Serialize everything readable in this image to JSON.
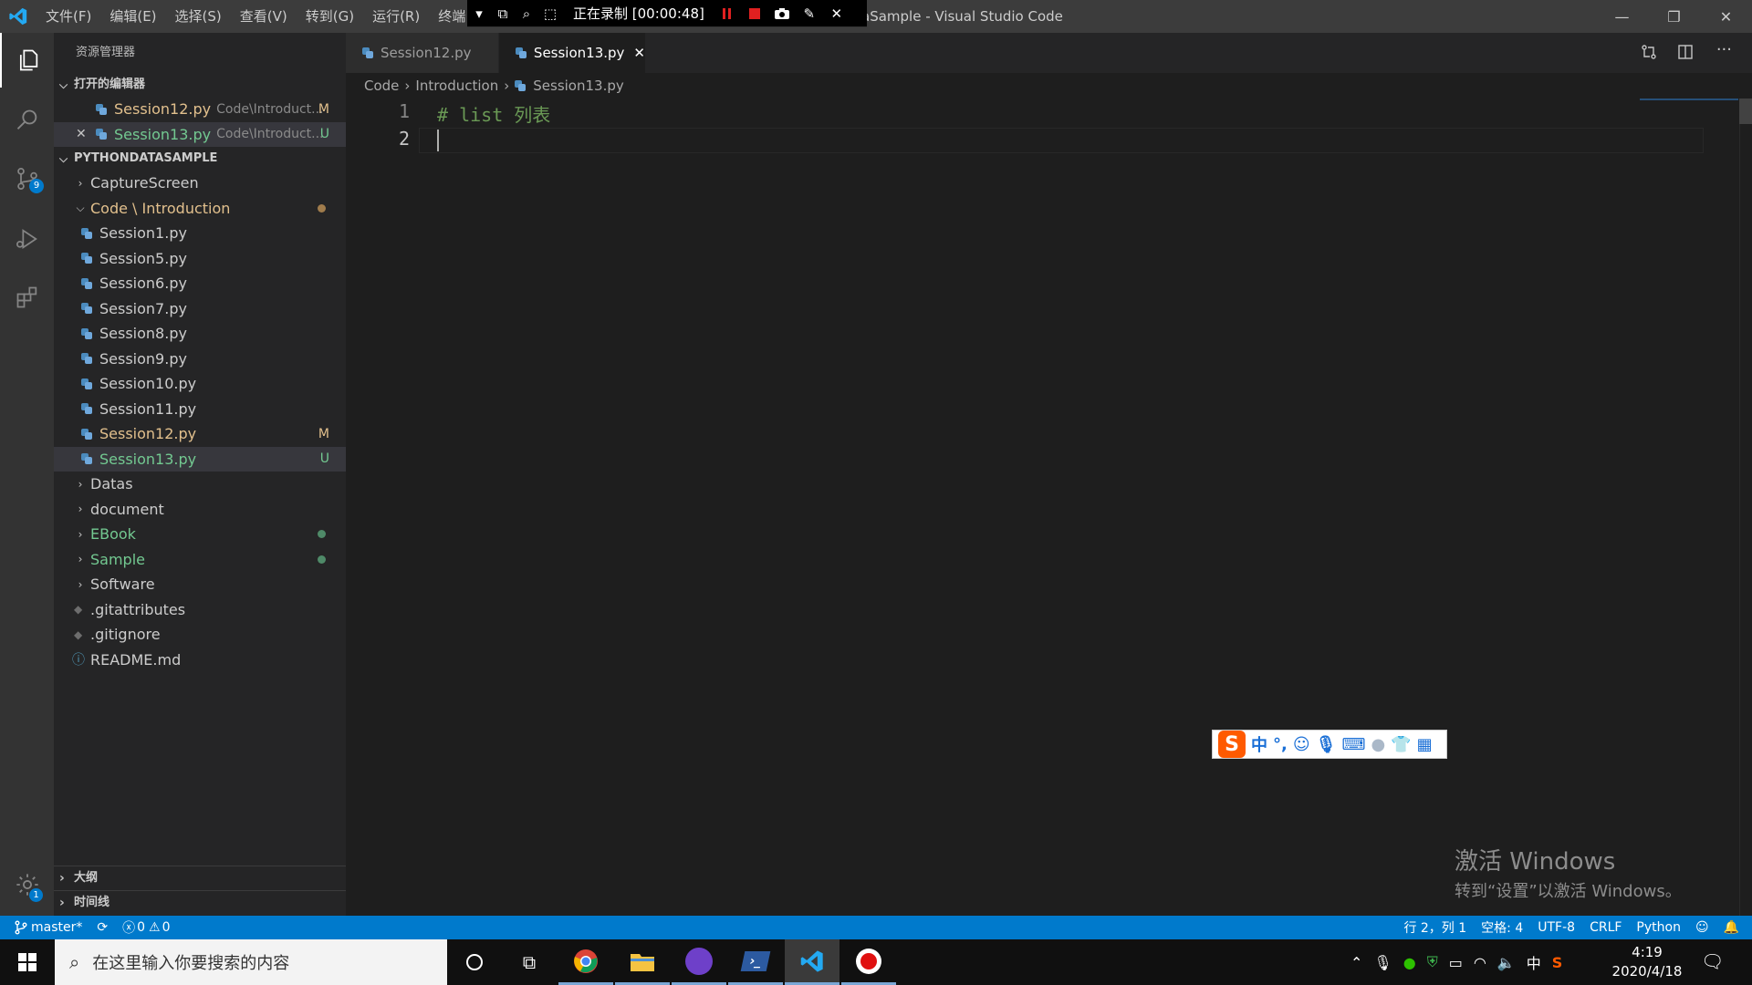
{
  "window": {
    "title": "aSample - Visual Studio Code"
  },
  "menu": [
    "文件(F)",
    "编辑(E)",
    "选择(S)",
    "查看(V)",
    "转到(G)",
    "运行(R)",
    "终端"
  ],
  "recorder": {
    "status": "正在录制 [00:00:48]"
  },
  "sidebar": {
    "title": "资源管理器",
    "open_editors": {
      "header": "打开的编辑器",
      "items": [
        {
          "name": "Session12.py",
          "path": "Code\\Introduct...",
          "badge": "M"
        },
        {
          "name": "Session13.py",
          "path": "Code\\Introduct...",
          "badge": "U"
        }
      ]
    },
    "workspace": {
      "header": "PYTHONDATASAMPLE",
      "items": [
        {
          "label": "CaptureScreen",
          "kind": "folder"
        },
        {
          "label": "Code \\ Introduction",
          "kind": "folder-open"
        },
        {
          "label": "Session1.py",
          "kind": "py"
        },
        {
          "label": "Session5.py",
          "kind": "py"
        },
        {
          "label": "Session6.py",
          "kind": "py"
        },
        {
          "label": "Session7.py",
          "kind": "py"
        },
        {
          "label": "Session8.py",
          "kind": "py"
        },
        {
          "label": "Session9.py",
          "kind": "py"
        },
        {
          "label": "Session10.py",
          "kind": "py"
        },
        {
          "label": "Session11.py",
          "kind": "py"
        },
        {
          "label": "Session12.py",
          "kind": "py",
          "badge": "M"
        },
        {
          "label": "Session13.py",
          "kind": "py",
          "badge": "U"
        },
        {
          "label": "Datas",
          "kind": "folder"
        },
        {
          "label": "document",
          "kind": "folder"
        },
        {
          "label": "EBook",
          "kind": "folder"
        },
        {
          "label": "Sample",
          "kind": "folder"
        },
        {
          "label": "Software",
          "kind": "folder"
        },
        {
          "label": ".gitattributes",
          "kind": "file"
        },
        {
          "label": ".gitignore",
          "kind": "file"
        },
        {
          "label": "README.md",
          "kind": "info"
        }
      ]
    },
    "outline": "大纲",
    "timeline": "时间线"
  },
  "activity": {
    "scm_badge": "9",
    "settings_badge": "1"
  },
  "tabs": [
    {
      "label": "Session12.py",
      "active": false
    },
    {
      "label": "Session13.py",
      "active": true
    }
  ],
  "breadcrumb": [
    "Code",
    "Introduction",
    "Session13.py"
  ],
  "editor": {
    "lines": [
      {
        "no": "1",
        "text": "# list 列表"
      },
      {
        "no": "2",
        "text": ""
      }
    ]
  },
  "statusbar": {
    "branch": "master*",
    "errors": "0",
    "warnings": "0",
    "position": "行 2，列 1",
    "spaces": "空格: 4",
    "encoding": "UTF-8",
    "eol": "CRLF",
    "language": "Python"
  },
  "watermark": {
    "line1": "激活 Windows",
    "line2": "转到“设置”以激活 Windows。"
  },
  "ime": {
    "label": "中"
  },
  "taskbar": {
    "search_placeholder": "在这里输入你要搜索的内容",
    "time": "4:19",
    "date": "2020/4/18",
    "ime_indicator": "中"
  },
  "colors": {
    "accent": "#007acc",
    "modified": "#e2c08d",
    "untracked": "#73c991",
    "comment": "#6a9955"
  }
}
